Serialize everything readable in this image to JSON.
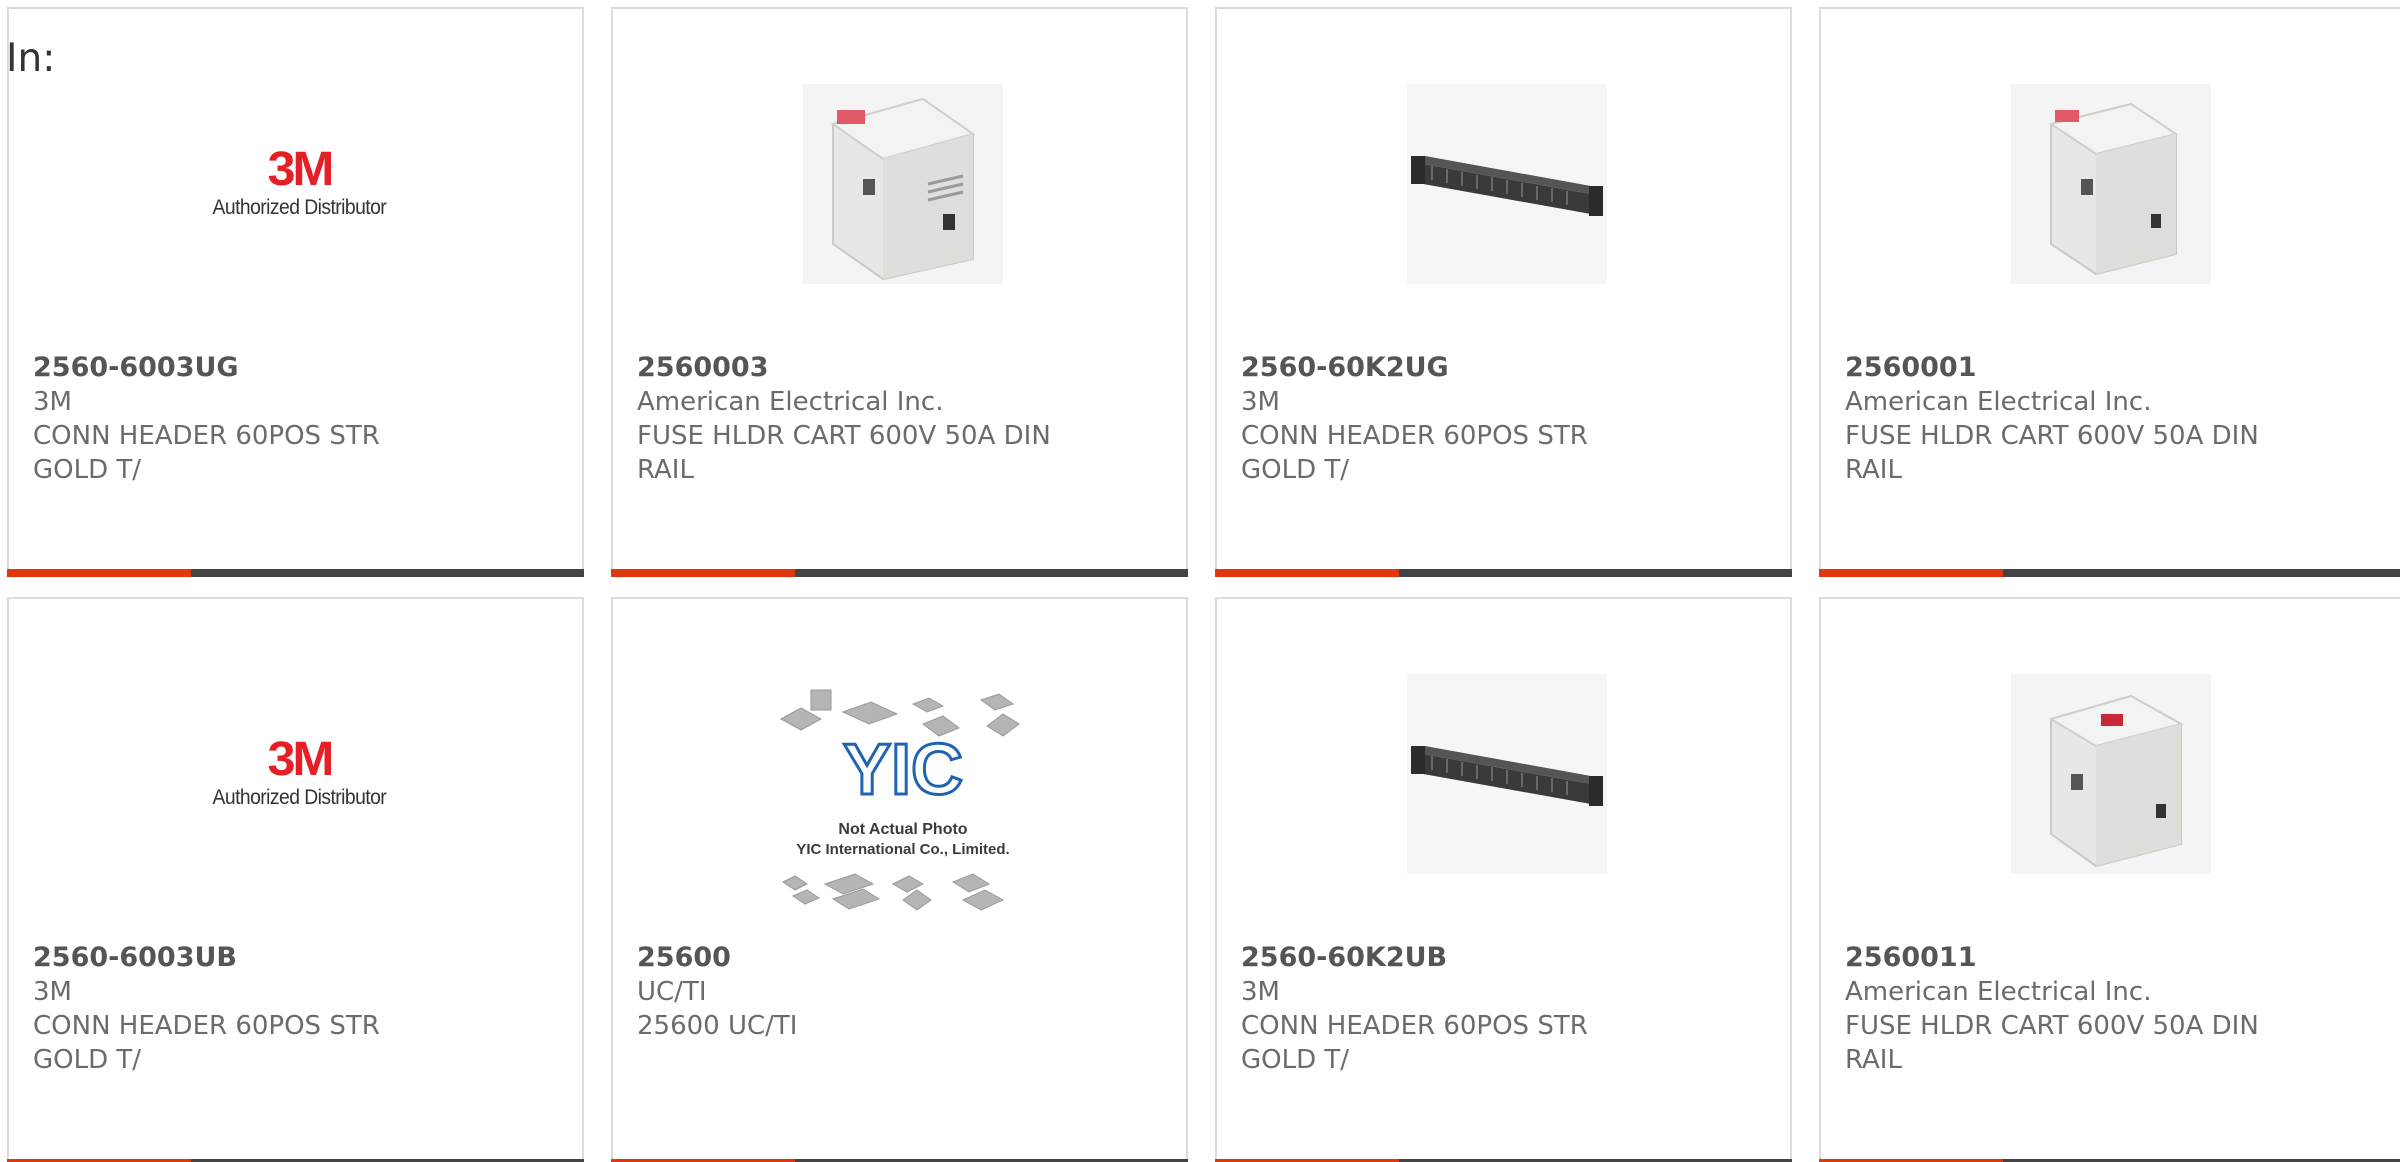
{
  "filter": {
    "label": "In:"
  },
  "accent_color": "#e0370f",
  "bar_color": "#444444",
  "products": [
    {
      "part_number": "2560-6003UG",
      "manufacturer": "3M",
      "description": "CONN HEADER 60POS STR GOLD T/",
      "image": "3m-authorized-distributor-logo",
      "logo_mark": "3M",
      "logo_sub": "Authorized Distributor"
    },
    {
      "part_number": "2560003",
      "manufacturer": "American Electrical Inc.",
      "description": "FUSE HLDR CART 600V 50A DIN RAIL",
      "image": "fuse-holder-photo"
    },
    {
      "part_number": "2560-60K2UG",
      "manufacturer": "3M",
      "description": "CONN HEADER 60POS STR GOLD T/",
      "image": "connector-header-photo"
    },
    {
      "part_number": "2560001",
      "manufacturer": "American Electrical Inc.",
      "description": "FUSE HLDR CART 600V 50A DIN RAIL",
      "image": "fuse-holder-photo"
    },
    {
      "part_number": "2560-6003UB",
      "manufacturer": "3M",
      "description": "CONN HEADER 60POS STR GOLD T/",
      "image": "3m-authorized-distributor-logo",
      "logo_mark": "3M",
      "logo_sub": "Authorized Distributor"
    },
    {
      "part_number": "25600",
      "manufacturer": "UC/TI",
      "description": "25600 UC/TI",
      "image": "yic-placeholder-image",
      "placeholder_line1": "Not Actual Photo",
      "placeholder_line2": "YIC International Co., Limited.",
      "placeholder_logo": "YIC"
    },
    {
      "part_number": "2560-60K2UB",
      "manufacturer": "3M",
      "description": "CONN HEADER 60POS STR GOLD T/",
      "image": "connector-header-photo"
    },
    {
      "part_number": "2560011",
      "manufacturer": "American Electrical Inc.",
      "description": "FUSE HLDR CART 600V 50A DIN RAIL",
      "image": "fuse-holder-photo"
    }
  ]
}
